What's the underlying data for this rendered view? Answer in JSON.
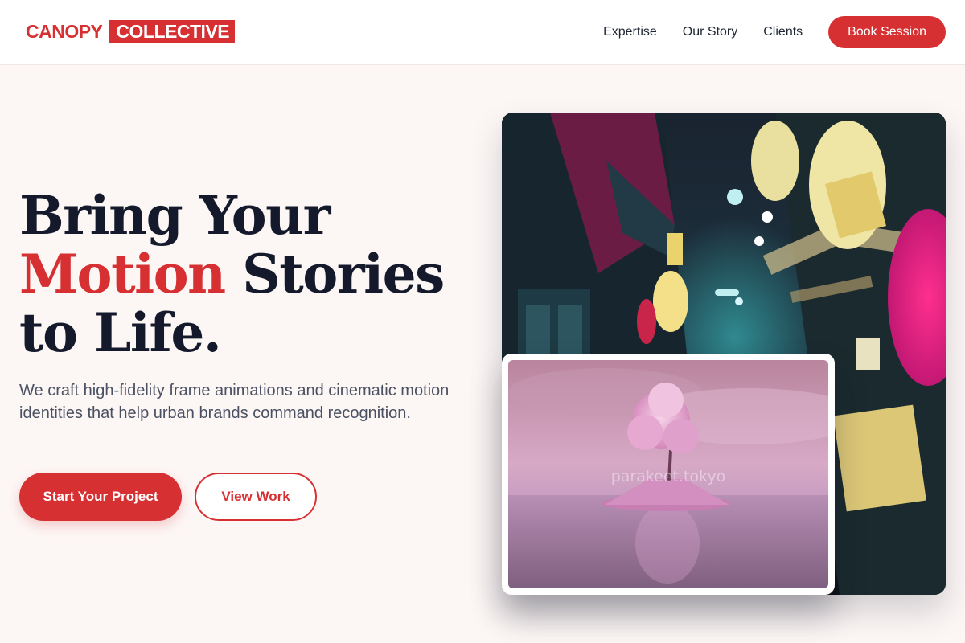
{
  "brand": {
    "part1": "CANOPY",
    "part2": "COLLECTIVE"
  },
  "nav": {
    "links": [
      "Expertise",
      "Our Story",
      "Clients"
    ],
    "cta": "Book Session"
  },
  "hero": {
    "line1": "Bring Your",
    "line2_accent": "Motion",
    "line2_rest": " Stories",
    "line3": "to Life.",
    "subtitle": "We craft high-fidelity frame animations and cinematic motion identities that help urban brands command recognition.",
    "primary_cta": "Start Your Project",
    "secondary_cta": "View Work"
  },
  "images": {
    "main_alt": "Neon-lit alley with hanging lanterns",
    "overlay_alt": "Pink tree on a small island in still water",
    "overlay_watermark": "parakeet.tokyo"
  },
  "colors": {
    "accent": "#d63032",
    "heading": "#141a2b",
    "body": "#4a5162",
    "page_bg": "#fcf6f5"
  }
}
